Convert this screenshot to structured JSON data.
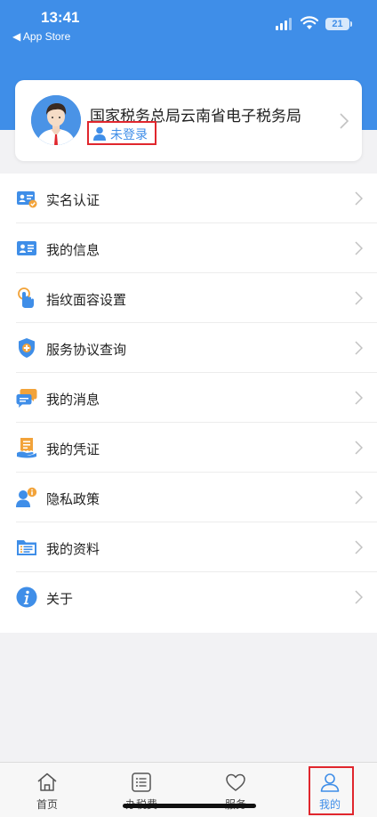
{
  "status_bar": {
    "time": "13:41",
    "back_label": "◀ App Store",
    "battery": "21"
  },
  "profile": {
    "org_name": "国家税务总局云南省电子税务局",
    "login_label": "未登录"
  },
  "menu": {
    "items": [
      {
        "label": "实名认证",
        "icon": "id-card-check-icon"
      },
      {
        "label": "我的信息",
        "icon": "user-info-card-icon"
      },
      {
        "label": "指纹面容设置",
        "icon": "fingerprint-tap-icon"
      },
      {
        "label": "服务协议查询",
        "icon": "shield-plus-icon"
      },
      {
        "label": "我的消息",
        "icon": "chat-bubbles-icon"
      },
      {
        "label": "我的凭证",
        "icon": "receipt-hand-icon"
      },
      {
        "label": "隐私政策",
        "icon": "user-info-badge-icon"
      },
      {
        "label": "我的资料",
        "icon": "folder-list-icon"
      },
      {
        "label": "关于",
        "icon": "info-circle-icon"
      }
    ]
  },
  "tabbar": {
    "tabs": [
      {
        "label": "首页",
        "icon": "home-icon"
      },
      {
        "label": "办税费",
        "icon": "list-icon"
      },
      {
        "label": "服务",
        "icon": "heart-icon"
      },
      {
        "label": "我的",
        "icon": "person-icon"
      }
    ],
    "active_index": 3
  },
  "colors": {
    "brand_blue": "#3f8ee8",
    "highlight_red": "#e0262d",
    "icon_orange": "#f2a33a"
  }
}
